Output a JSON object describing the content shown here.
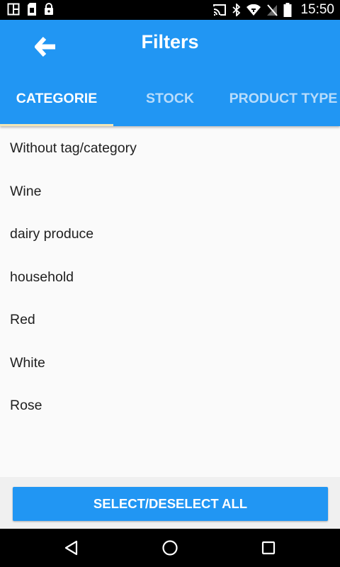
{
  "status_bar": {
    "time": "15:50",
    "icons": [
      "window-icon",
      "sim-icon",
      "lock-icon",
      "cast-icon",
      "bluetooth-icon",
      "wifi-icon",
      "no-signal-icon",
      "battery-icon"
    ]
  },
  "app_bar": {
    "back_icon": "arrow-left-icon",
    "title": "Filters",
    "color": "#2196f3"
  },
  "tabs": [
    {
      "label": "CATEGORIE",
      "active": true
    },
    {
      "label": "STOCK",
      "active": false
    },
    {
      "label": "PRODUCT TYPE",
      "active": false
    }
  ],
  "categories": [
    {
      "label": "Without tag/category"
    },
    {
      "label": "Wine"
    },
    {
      "label": "dairy produce"
    },
    {
      "label": "household"
    },
    {
      "label": "Red"
    },
    {
      "label": "White"
    },
    {
      "label": "Rose"
    }
  ],
  "footer": {
    "select_all_label": "SELECT/DESELECT ALL"
  },
  "nav_bar": {
    "buttons": [
      "back-triangle-icon",
      "home-circle-icon",
      "recents-square-icon"
    ]
  }
}
